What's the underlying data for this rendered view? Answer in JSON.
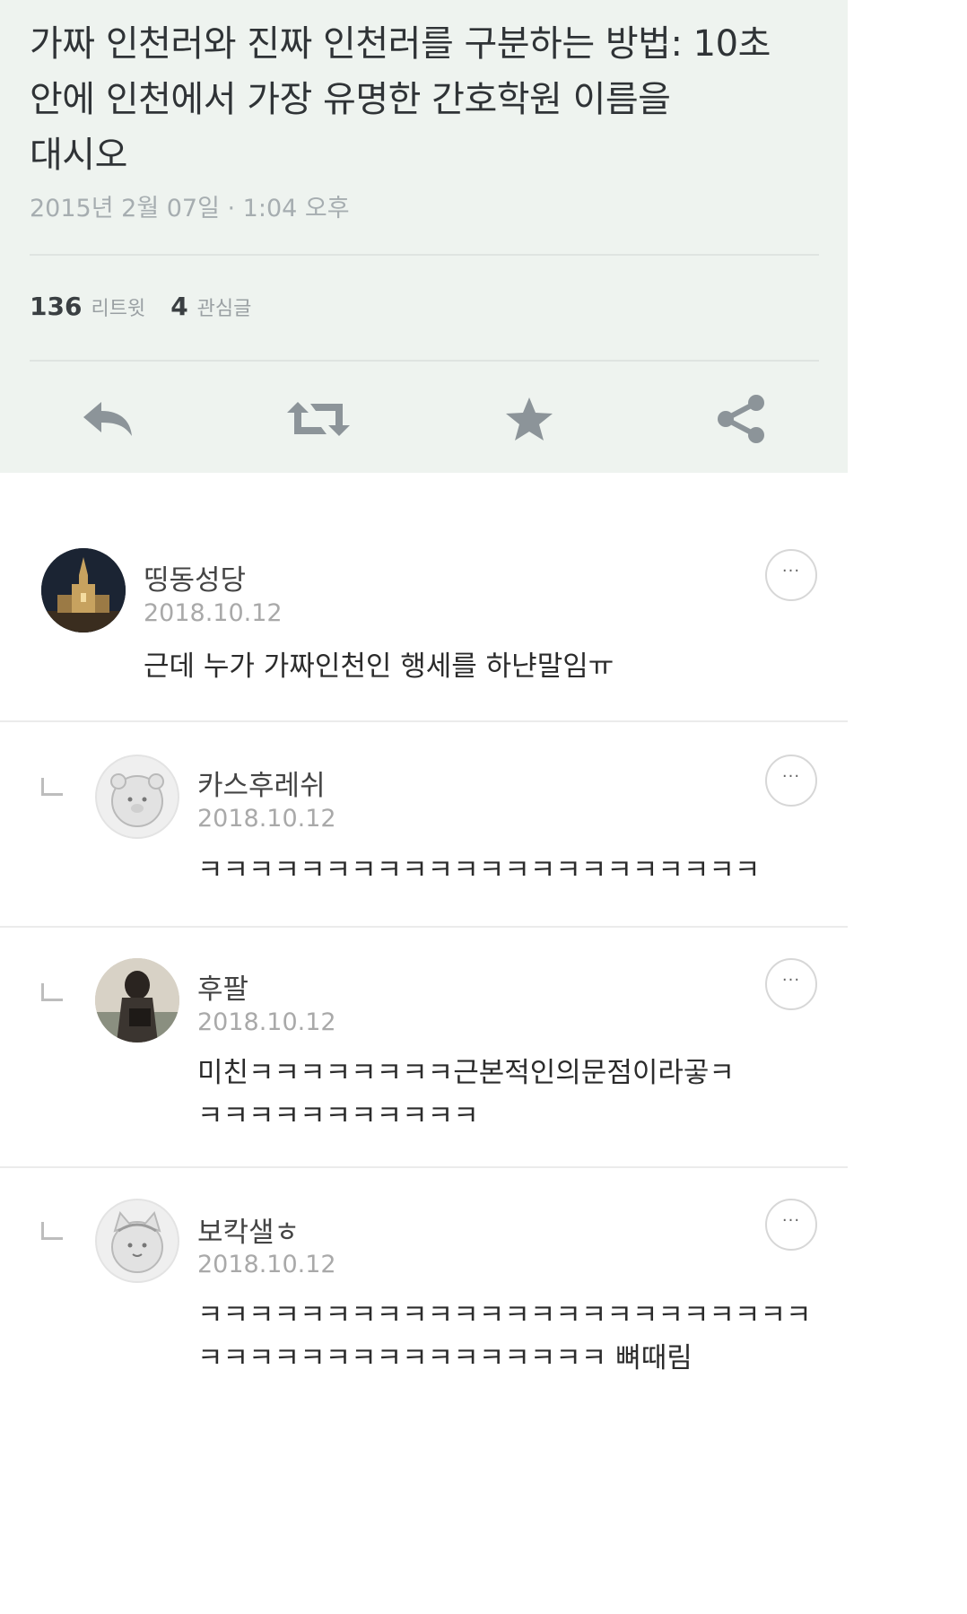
{
  "tweet": {
    "text_line1": "가짜 인천러와 진짜 인천러를 구분하는 방법: 10초",
    "text_line2": "안에 인천에서 가장 유명한 간호학원 이름을",
    "text_line3": "대시오",
    "timestamp": "2015년 2월 07일 · 1:04 오후",
    "retweet_count": "136",
    "retweet_label": "리트윗",
    "like_count": "4",
    "like_label": "관심글",
    "colors": {
      "card_bg": "#eef3ef",
      "icon": "#8c9499"
    },
    "icons": [
      "reply-icon",
      "retweet-icon",
      "star-icon",
      "share-icon"
    ]
  },
  "comments": [
    {
      "author": "띵동성당",
      "date": "2018.10.12",
      "line1": "근데 누가 가짜인천인 행세를 하냔말임ㅠ",
      "line2": "",
      "reply": false,
      "avatar": "cathedral-night"
    },
    {
      "author": "카스후레쉬",
      "date": "2018.10.12",
      "line1": "ㅋㅋㅋㅋㅋㅋㅋㅋㅋㅋㅋㅋㅋㅋㅋㅋㅋㅋㅋㅋㅋㅋ",
      "line2": "",
      "reply": true,
      "avatar": "default-bear"
    },
    {
      "author": "후팔",
      "date": "2018.10.12",
      "line1": "미친ㅋㅋㅋㅋㅋㅋㅋㅋ근본적인의문점이라곻ㅋ",
      "line2": "ㅋㅋㅋㅋㅋㅋㅋㅋㅋㅋㅋ",
      "reply": true,
      "avatar": "photo-person"
    },
    {
      "author": "보칵샐ㅎ",
      "date": "2018.10.12",
      "line1": "ㅋㅋㅋㅋㅋㅋㅋㅋㅋㅋㅋㅋㅋㅋㅋㅋㅋㅋㅋㅋㅋㅋㅋㅋ",
      "line2": "ㅋㅋㅋㅋㅋㅋㅋㅋㅋㅋㅋㅋㅋㅋㅋㅋ 뼈때림",
      "reply": true,
      "avatar": "default-cat"
    }
  ],
  "more_label": "···"
}
